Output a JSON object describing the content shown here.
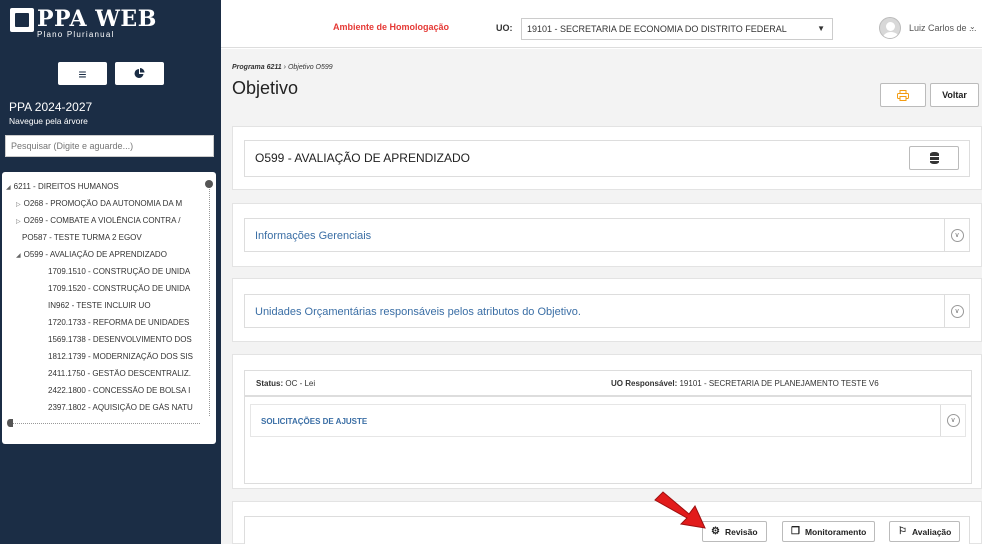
{
  "app": {
    "logo_title": "PPA WEB",
    "logo_subtitle": "Plano Plurianual"
  },
  "sidebar": {
    "menu_icon": "hamburger-icon",
    "chart_icon": "pie-chart-icon",
    "ppa_period": "PPA 2024-2027",
    "hint": "Navegue pela árvore",
    "search_placeholder": "Pesquisar (Digite e aguarde...)",
    "tree": [
      {
        "label": "6211 - DIREITOS HUMANOS",
        "toggle": "◢"
      },
      {
        "label": "O268 - PROMOÇÃO DA AUTONOMIA DA M",
        "toggle": "▷"
      },
      {
        "label": "O269 - COMBATE A VIOLÊNCIA CONTRA /",
        "toggle": "▷"
      },
      {
        "label": "PO587 - TESTE TURMA 2 EGOV",
        "toggle": ""
      },
      {
        "label": "O599 - AVALIAÇÃO DE APRENDIZADO",
        "toggle": "◢"
      },
      {
        "label": "1709.1510 - CONSTRUÇÃO DE UNIDA",
        "toggle": ""
      },
      {
        "label": "1709.1520 - CONSTRUÇÃO DE UNIDA",
        "toggle": ""
      },
      {
        "label": "IN962 - TESTE INCLUIR UO",
        "toggle": ""
      },
      {
        "label": "1720.1733 - REFORMA DE UNIDADES",
        "toggle": ""
      },
      {
        "label": "1569.1738 - DESENVOLVIMENTO DOS",
        "toggle": ""
      },
      {
        "label": "1812.1739 - MODERNIZAÇÃO DOS SIS",
        "toggle": ""
      },
      {
        "label": "2411.1750 - GESTÃO DESCENTRALIZ.",
        "toggle": ""
      },
      {
        "label": "2422.1800 - CONCESSÃO DE BOLSA I",
        "toggle": ""
      },
      {
        "label": "2397.1802 - AQUISIÇÃO DE GÁS NATU",
        "toggle": ""
      }
    ]
  },
  "header": {
    "environment": "Ambiente de Homologação",
    "uo_label": "UO:",
    "uo_value": "19101 - SECRETARIA DE ECONOMIA DO DISTRITO FEDERAL",
    "user_name": "Luiz Carlos de ...",
    "env_color": "#e53935"
  },
  "main": {
    "breadcrumb_program": "Programa 6211",
    "breadcrumb_sep": "›",
    "breadcrumb_current": "Objetivo O599",
    "title": "Objetivo",
    "back_label": "Voltar",
    "objective_title": "O599 - AVALIAÇÃO DE APRENDIZADO",
    "section_info": "Informações Gerenciais",
    "section_units": "Unidades Orçamentárias responsáveis pelos atributos do Objetivo.",
    "status_label": "Status:",
    "status_value": "OC - Lei",
    "uo_resp_label": "UO Responsável:",
    "uo_resp_value": "19101 - SECRETARIA DE PLANEJAMENTO TESTE V6",
    "solicitations": "SOLICITAÇÕES DE AJUSTE",
    "actions": {
      "revisao": "Revisão",
      "monitoramento": "Monitoramento",
      "avaliacao": "Avaliação"
    },
    "link_color": "#3a6ea5"
  }
}
